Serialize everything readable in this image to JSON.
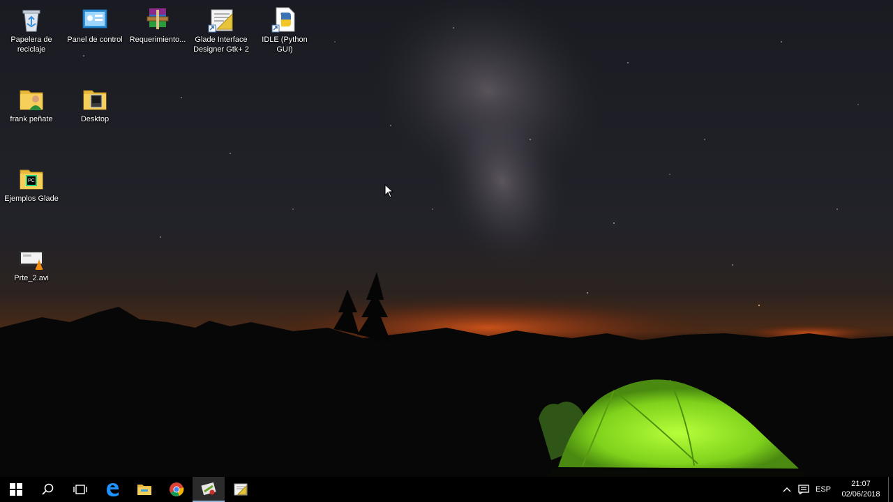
{
  "desktop": {
    "icons": [
      {
        "label": "Papelera de reciclaje",
        "icon": "recycle-bin-icon"
      },
      {
        "label": "Panel de control",
        "icon": "control-panel-icon"
      },
      {
        "label": "Requerimiento...",
        "icon": "winrar-archive-icon"
      },
      {
        "label": "Glade Interface Designer Gtk+ 2",
        "icon": "glade-shortcut-icon"
      },
      {
        "label": "IDLE (Python GUI)",
        "icon": "python-shortcut-icon"
      },
      {
        "label": "frank peñate",
        "icon": "user-folder-icon"
      },
      {
        "label": "Desktop",
        "icon": "folder-icon"
      },
      {
        "label": "Ejemplos Glade",
        "icon": "pycharm-folder-icon"
      },
      {
        "label": "Prte_2.avi",
        "icon": "vlc-video-file-icon"
      }
    ]
  },
  "taskbar": {
    "buttons": [
      {
        "name": "start",
        "icon": "windows-start-icon"
      },
      {
        "name": "search",
        "icon": "search-icon"
      },
      {
        "name": "task-view",
        "icon": "task-view-icon"
      },
      {
        "name": "edge",
        "icon": "edge-browser-icon"
      },
      {
        "name": "file-explorer",
        "icon": "file-explorer-icon"
      },
      {
        "name": "chrome",
        "icon": "chrome-icon"
      },
      {
        "name": "glade",
        "icon": "glade-app-icon"
      },
      {
        "name": "glade-2",
        "icon": "glade-designer-icon"
      }
    ],
    "tray": {
      "language": "ESP",
      "time": "21:07",
      "date": "02/06/2018"
    }
  },
  "colors": {
    "taskbar_bg": "#000000",
    "tent_green": "#8ee02a",
    "horizon_orange": "#e0581a"
  }
}
